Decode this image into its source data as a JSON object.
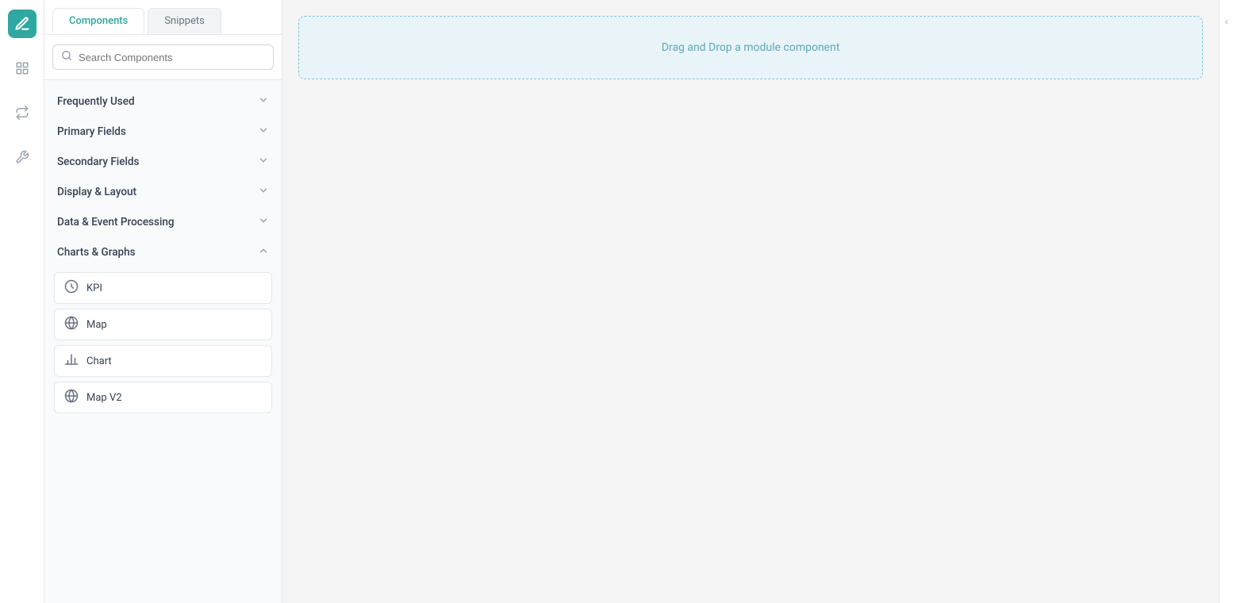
{
  "iconRail": {
    "logo": "✎",
    "items": [
      {
        "name": "grid-icon",
        "symbol": "⊞",
        "label": "Grid"
      },
      {
        "name": "swap-icon",
        "symbol": "⇄",
        "label": "Swap"
      },
      {
        "name": "wrench-icon",
        "symbol": "🔧",
        "label": "Settings"
      }
    ]
  },
  "tabs": [
    {
      "id": "components",
      "label": "Components",
      "active": true
    },
    {
      "id": "snippets",
      "label": "Snippets",
      "active": false
    }
  ],
  "search": {
    "placeholder": "Search Components"
  },
  "sections": [
    {
      "id": "frequently-used",
      "label": "Frequently Used",
      "expanded": false,
      "chevron": "∨",
      "items": []
    },
    {
      "id": "primary-fields",
      "label": "Primary Fields",
      "expanded": false,
      "chevron": "∨",
      "items": []
    },
    {
      "id": "secondary-fields",
      "label": "Secondary Fields",
      "expanded": false,
      "chevron": "∨",
      "items": []
    },
    {
      "id": "display-layout",
      "label": "Display & Layout",
      "expanded": false,
      "chevron": "∨",
      "items": []
    },
    {
      "id": "data-event-processing",
      "label": "Data & Event Processing",
      "expanded": false,
      "chevron": "∨",
      "items": []
    },
    {
      "id": "charts-graphs",
      "label": "Charts & Graphs",
      "expanded": true,
      "chevron": "∧",
      "items": [
        {
          "id": "kpi",
          "label": "KPI",
          "icon": "kpi"
        },
        {
          "id": "map",
          "label": "Map",
          "icon": "globe"
        },
        {
          "id": "chart",
          "label": "Chart",
          "icon": "chart"
        },
        {
          "id": "map-v2",
          "label": "Map V2",
          "icon": "globe"
        }
      ]
    }
  ],
  "canvas": {
    "dropZoneText": "Drag and Drop a module component"
  },
  "rightPanel": {
    "collapseIcon": "‹"
  }
}
